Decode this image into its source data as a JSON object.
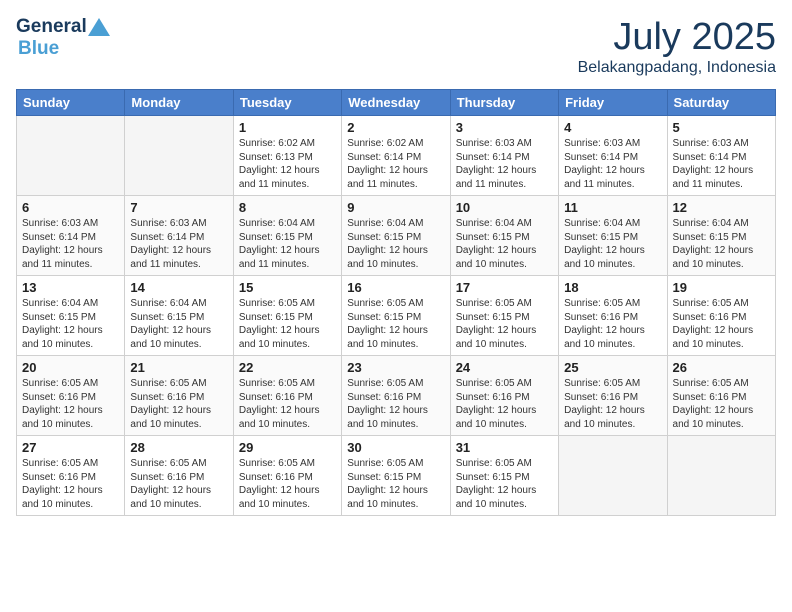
{
  "header": {
    "logo_general": "General",
    "logo_blue": "Blue",
    "month": "July 2025",
    "location": "Belakangpadang, Indonesia"
  },
  "weekdays": [
    "Sunday",
    "Monday",
    "Tuesday",
    "Wednesday",
    "Thursday",
    "Friday",
    "Saturday"
  ],
  "weeks": [
    [
      {
        "day": "",
        "empty": true
      },
      {
        "day": "",
        "empty": true
      },
      {
        "day": "1",
        "sunrise": "6:02 AM",
        "sunset": "6:13 PM",
        "daylight": "12 hours and 11 minutes."
      },
      {
        "day": "2",
        "sunrise": "6:02 AM",
        "sunset": "6:14 PM",
        "daylight": "12 hours and 11 minutes."
      },
      {
        "day": "3",
        "sunrise": "6:03 AM",
        "sunset": "6:14 PM",
        "daylight": "12 hours and 11 minutes."
      },
      {
        "day": "4",
        "sunrise": "6:03 AM",
        "sunset": "6:14 PM",
        "daylight": "12 hours and 11 minutes."
      },
      {
        "day": "5",
        "sunrise": "6:03 AM",
        "sunset": "6:14 PM",
        "daylight": "12 hours and 11 minutes."
      }
    ],
    [
      {
        "day": "6",
        "sunrise": "6:03 AM",
        "sunset": "6:14 PM",
        "daylight": "12 hours and 11 minutes."
      },
      {
        "day": "7",
        "sunrise": "6:03 AM",
        "sunset": "6:14 PM",
        "daylight": "12 hours and 11 minutes."
      },
      {
        "day": "8",
        "sunrise": "6:04 AM",
        "sunset": "6:15 PM",
        "daylight": "12 hours and 11 minutes."
      },
      {
        "day": "9",
        "sunrise": "6:04 AM",
        "sunset": "6:15 PM",
        "daylight": "12 hours and 10 minutes."
      },
      {
        "day": "10",
        "sunrise": "6:04 AM",
        "sunset": "6:15 PM",
        "daylight": "12 hours and 10 minutes."
      },
      {
        "day": "11",
        "sunrise": "6:04 AM",
        "sunset": "6:15 PM",
        "daylight": "12 hours and 10 minutes."
      },
      {
        "day": "12",
        "sunrise": "6:04 AM",
        "sunset": "6:15 PM",
        "daylight": "12 hours and 10 minutes."
      }
    ],
    [
      {
        "day": "13",
        "sunrise": "6:04 AM",
        "sunset": "6:15 PM",
        "daylight": "12 hours and 10 minutes."
      },
      {
        "day": "14",
        "sunrise": "6:04 AM",
        "sunset": "6:15 PM",
        "daylight": "12 hours and 10 minutes."
      },
      {
        "day": "15",
        "sunrise": "6:05 AM",
        "sunset": "6:15 PM",
        "daylight": "12 hours and 10 minutes."
      },
      {
        "day": "16",
        "sunrise": "6:05 AM",
        "sunset": "6:15 PM",
        "daylight": "12 hours and 10 minutes."
      },
      {
        "day": "17",
        "sunrise": "6:05 AM",
        "sunset": "6:15 PM",
        "daylight": "12 hours and 10 minutes."
      },
      {
        "day": "18",
        "sunrise": "6:05 AM",
        "sunset": "6:16 PM",
        "daylight": "12 hours and 10 minutes."
      },
      {
        "day": "19",
        "sunrise": "6:05 AM",
        "sunset": "6:16 PM",
        "daylight": "12 hours and 10 minutes."
      }
    ],
    [
      {
        "day": "20",
        "sunrise": "6:05 AM",
        "sunset": "6:16 PM",
        "daylight": "12 hours and 10 minutes."
      },
      {
        "day": "21",
        "sunrise": "6:05 AM",
        "sunset": "6:16 PM",
        "daylight": "12 hours and 10 minutes."
      },
      {
        "day": "22",
        "sunrise": "6:05 AM",
        "sunset": "6:16 PM",
        "daylight": "12 hours and 10 minutes."
      },
      {
        "day": "23",
        "sunrise": "6:05 AM",
        "sunset": "6:16 PM",
        "daylight": "12 hours and 10 minutes."
      },
      {
        "day": "24",
        "sunrise": "6:05 AM",
        "sunset": "6:16 PM",
        "daylight": "12 hours and 10 minutes."
      },
      {
        "day": "25",
        "sunrise": "6:05 AM",
        "sunset": "6:16 PM",
        "daylight": "12 hours and 10 minutes."
      },
      {
        "day": "26",
        "sunrise": "6:05 AM",
        "sunset": "6:16 PM",
        "daylight": "12 hours and 10 minutes."
      }
    ],
    [
      {
        "day": "27",
        "sunrise": "6:05 AM",
        "sunset": "6:16 PM",
        "daylight": "12 hours and 10 minutes."
      },
      {
        "day": "28",
        "sunrise": "6:05 AM",
        "sunset": "6:16 PM",
        "daylight": "12 hours and 10 minutes."
      },
      {
        "day": "29",
        "sunrise": "6:05 AM",
        "sunset": "6:16 PM",
        "daylight": "12 hours and 10 minutes."
      },
      {
        "day": "30",
        "sunrise": "6:05 AM",
        "sunset": "6:15 PM",
        "daylight": "12 hours and 10 minutes."
      },
      {
        "day": "31",
        "sunrise": "6:05 AM",
        "sunset": "6:15 PM",
        "daylight": "12 hours and 10 minutes."
      },
      {
        "day": "",
        "empty": true
      },
      {
        "day": "",
        "empty": true
      }
    ]
  ],
  "labels": {
    "sunrise": "Sunrise:",
    "sunset": "Sunset:",
    "daylight": "Daylight:"
  }
}
